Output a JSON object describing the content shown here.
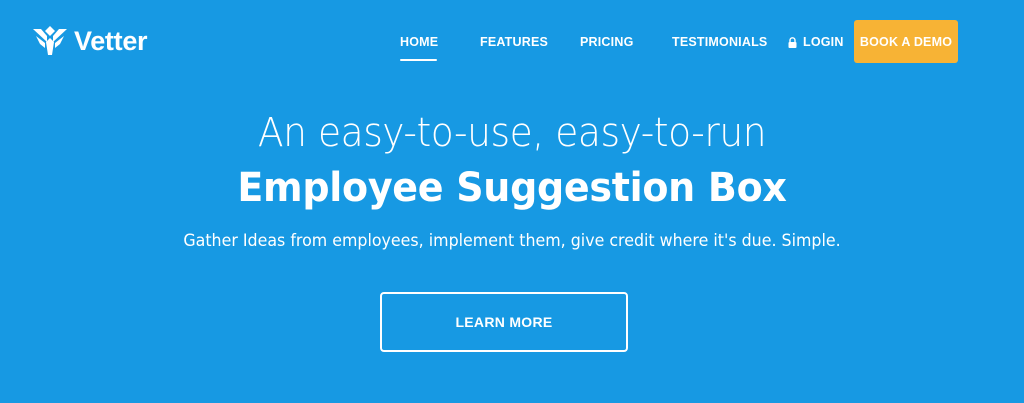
{
  "brand": {
    "name": "Vetter",
    "logo_icon": "vetter-logo-icon"
  },
  "nav": {
    "items": [
      {
        "label": "HOME",
        "active": true
      },
      {
        "label": "FEATURES",
        "active": false
      },
      {
        "label": "PRICING",
        "active": false
      },
      {
        "label": "TESTIMONIALS",
        "active": false
      }
    ],
    "login": {
      "label": "LOGIN",
      "icon": "lock-icon"
    },
    "cta": {
      "label": "BOOK A DEMO"
    }
  },
  "hero": {
    "headline_light": "An easy-to-use, easy-to-run",
    "headline_bold": "Employee Suggestion Box",
    "tagline": "Gather Ideas from employees, implement them, give credit where it's due. Simple.",
    "button_label": "LEARN MORE"
  },
  "colors": {
    "background": "#1799e3",
    "cta": "#f7b335",
    "text": "#ffffff"
  }
}
